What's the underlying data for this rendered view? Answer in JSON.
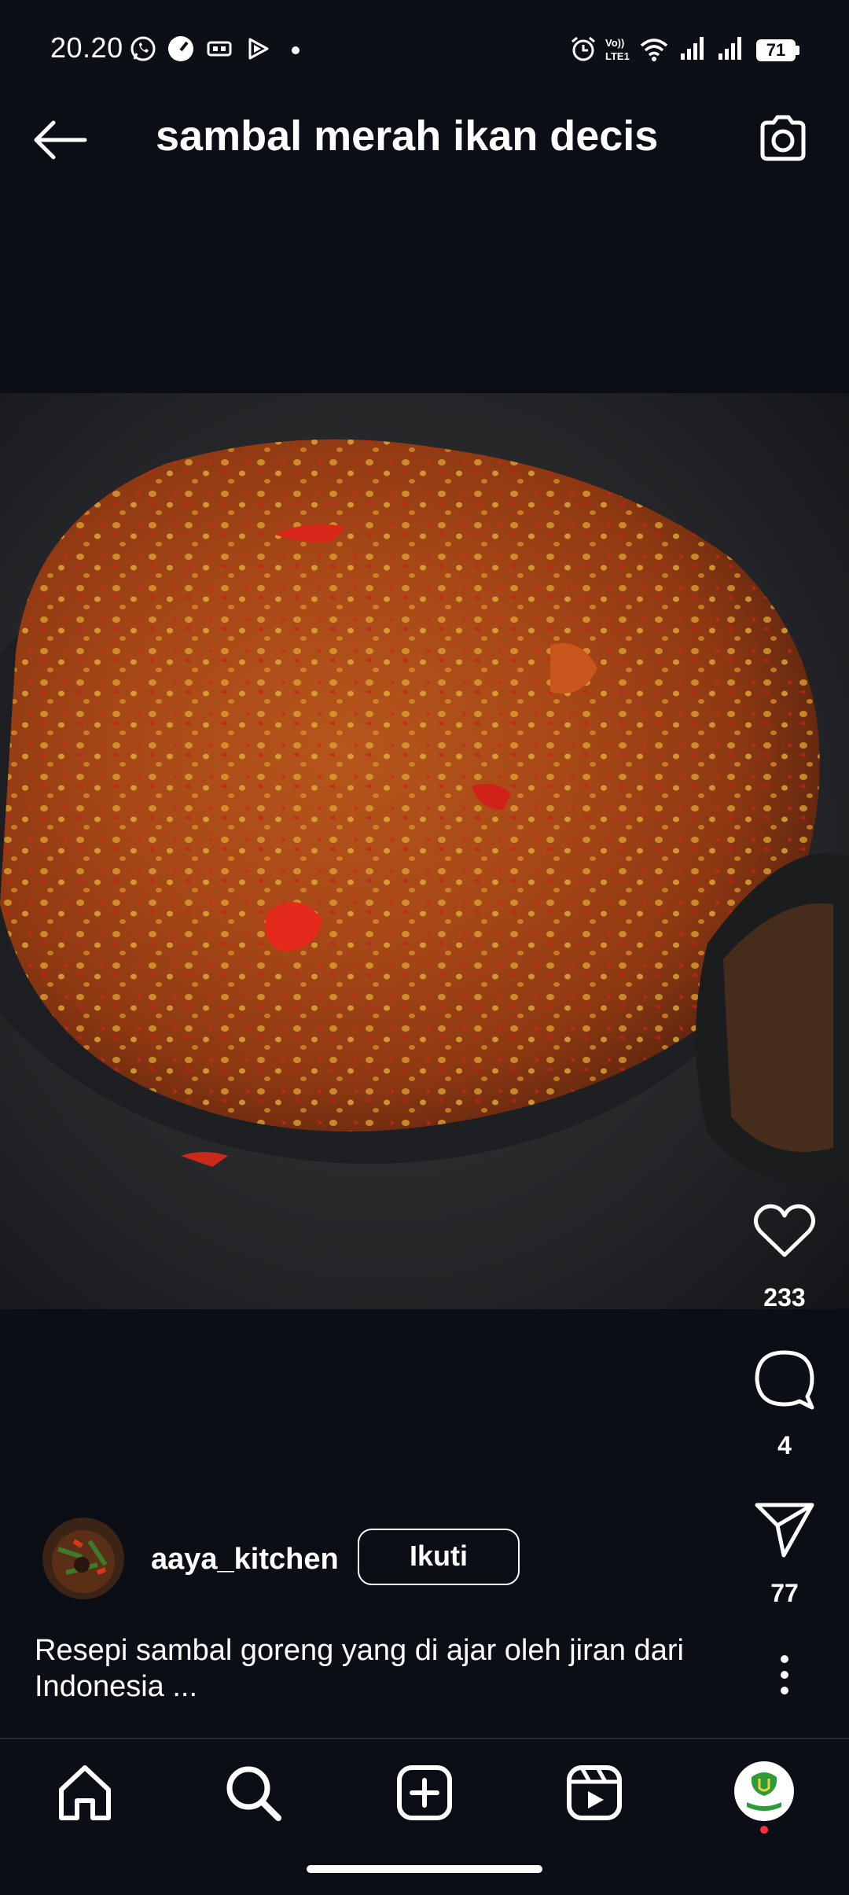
{
  "status_bar": {
    "time": "20.20",
    "battery": "71",
    "icons": [
      "whatsapp-icon",
      "speedometer-icon",
      "card-icon",
      "play-icon",
      "dot-icon",
      "alarm-icon",
      "volte-icon",
      "wifi-icon",
      "signal-icon",
      "signal-icon",
      "battery-icon"
    ]
  },
  "header": {
    "title": "sambal merah ikan decis",
    "back_icon": "back-arrow-icon",
    "camera_icon": "camera-icon"
  },
  "post": {
    "media_description_icon": "food-photo",
    "likes": "233",
    "comments": "4",
    "shares": "77",
    "username": "aaya_kitchen",
    "follow_label": "Ikuti",
    "caption": "Resepi sambal goreng yang di ajar oleh jiran dari Indonesia ..."
  },
  "nav": {
    "items": [
      "home-icon",
      "search-icon",
      "create-icon",
      "reels-icon",
      "profile-avatar"
    ]
  },
  "colors": {
    "background": "#0b0f15",
    "text": "#ffffff",
    "notification_dot": "#ff3040"
  }
}
